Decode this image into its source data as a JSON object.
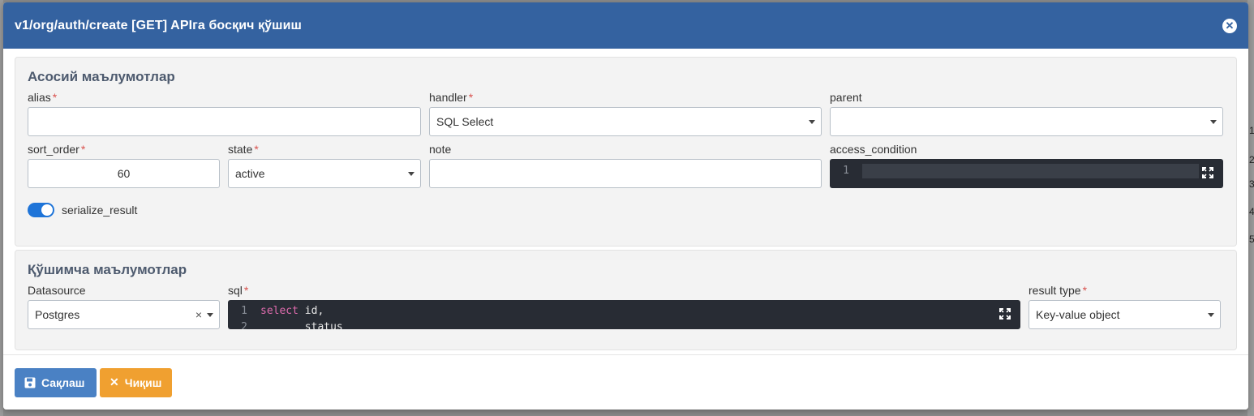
{
  "modal": {
    "title": "v1/org/auth/create [GET] APIга босқич қўшиш"
  },
  "main_panel": {
    "title": "Асосий маълумотлар",
    "alias": {
      "label": "alias",
      "value": ""
    },
    "handler": {
      "label": "handler",
      "value": "SQL Select"
    },
    "parent": {
      "label": "parent",
      "value": ""
    },
    "sort_order": {
      "label": "sort_order",
      "value": "60"
    },
    "state": {
      "label": "state",
      "value": "active"
    },
    "note": {
      "label": "note",
      "value": ""
    },
    "access_condition": {
      "label": "access_condition",
      "line_number": "1"
    },
    "serialize_result": {
      "label": "serialize_result",
      "checked": true
    }
  },
  "extra_panel": {
    "title": "Қўшимча маълумотлар",
    "datasource": {
      "label": "Datasource",
      "value": "Postgres",
      "clear": "×"
    },
    "sql": {
      "label": "sql",
      "lines": [
        {
          "num": "1",
          "keyword": "select",
          "text": " id,"
        },
        {
          "num": "2",
          "keyword": "",
          "text": "       status"
        }
      ]
    },
    "result_type": {
      "label": "result type",
      "value": "Key-value object"
    }
  },
  "footer": {
    "save_label": "Сақлаш",
    "exit_label": "Чиқиш"
  },
  "backdrop": {
    "row_numbers": [
      "1",
      "2",
      "3",
      "4",
      "5"
    ]
  },
  "colors": {
    "header": "#3462a0",
    "save": "#4a81c4",
    "exit": "#f0a030",
    "toggle": "#1e74d8",
    "required": "#d9534f"
  }
}
